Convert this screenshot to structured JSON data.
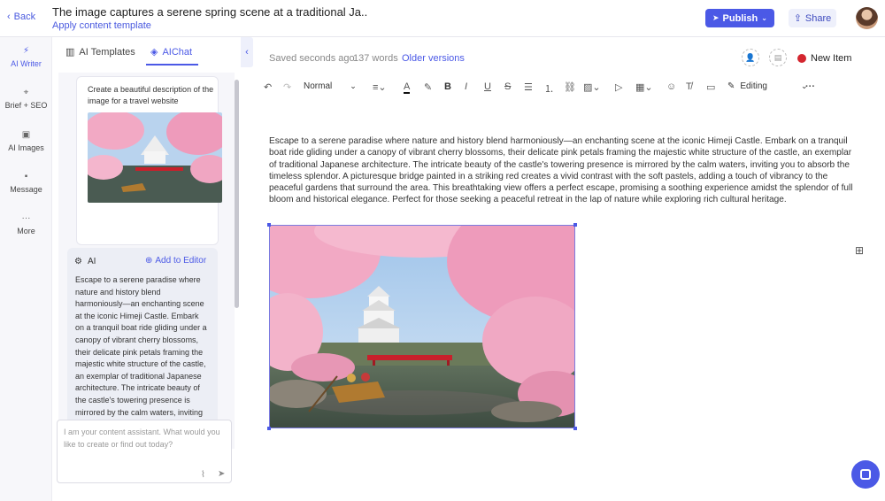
{
  "header": {
    "back_label": "Back",
    "title": "The image captures a serene spring scene at a traditional Ja..",
    "apply_template": "Apply content template",
    "publish_label": "Publish",
    "share_label": "Share"
  },
  "leftnav": {
    "items": [
      {
        "label": "AI Writer",
        "icon": "bolt-icon",
        "active": true
      },
      {
        "label": "Brief + SEO",
        "icon": "target-icon",
        "active": false
      },
      {
        "label": "AI Images",
        "icon": "image-icon",
        "active": false
      },
      {
        "label": "Message",
        "icon": "message-icon",
        "active": false
      },
      {
        "label": "More",
        "icon": "more-icon",
        "active": false
      }
    ]
  },
  "chat": {
    "tabs": [
      {
        "label": "AI Templates",
        "active": false
      },
      {
        "label": "AIChat",
        "active": true
      }
    ],
    "user_message": "Create a beautiful description of the image for a travel website",
    "ai_label": "AI",
    "add_to_editor": "Add to Editor",
    "ai_response": "Escape to a serene paradise where nature and history blend harmoniously—an enchanting scene at the iconic Himeji Castle. Embark on a tranquil boat ride gliding under a canopy of vibrant cherry blossoms, their delicate pink petals framing the majestic white structure of the castle, an exemplar of traditional Japanese architecture. The intricate beauty of the castle's towering presence is mirrored by the calm waters, inviting you to absorb the timeless splendor. A picturesque bridge painted in a striking red creates a vivid contrast",
    "input_placeholder": "I am your content assistant. What would you like to create or find out today?"
  },
  "editor": {
    "saved_status": "Saved seconds ago",
    "word_count": "137 words",
    "older_versions": "Older versions",
    "new_item": "New Item",
    "new_item_color": "#d4262f",
    "toolbar": {
      "style_select": "Normal",
      "mode_select": "Editing"
    },
    "body": "Escape to a serene paradise where nature and history blend harmoniously—an enchanting scene at the iconic Himeji Castle. Embark on a tranquil boat ride gliding under a canopy of vibrant cherry blossoms, their delicate pink petals framing the majestic white structure of the castle, an exemplar of traditional Japanese architecture. The intricate beauty of the castle's towering presence is mirrored by the calm waters, inviting you to absorb the timeless splendor. A picturesque bridge painted in a striking red creates a vivid contrast with the soft pastels, adding a touch of vibrancy to the peaceful gardens that surround the area. This breathtaking view offers a perfect escape, promising a soothing experience amidst the splendor of full bloom and historical elegance. Perfect for those seeking a peaceful retreat in the lap of nature while exploring rich cultural heritage."
  },
  "colors": {
    "accent": "#4b59e6",
    "sakura_pink": "#f2a9c4",
    "bridge_red": "#c8202b"
  }
}
